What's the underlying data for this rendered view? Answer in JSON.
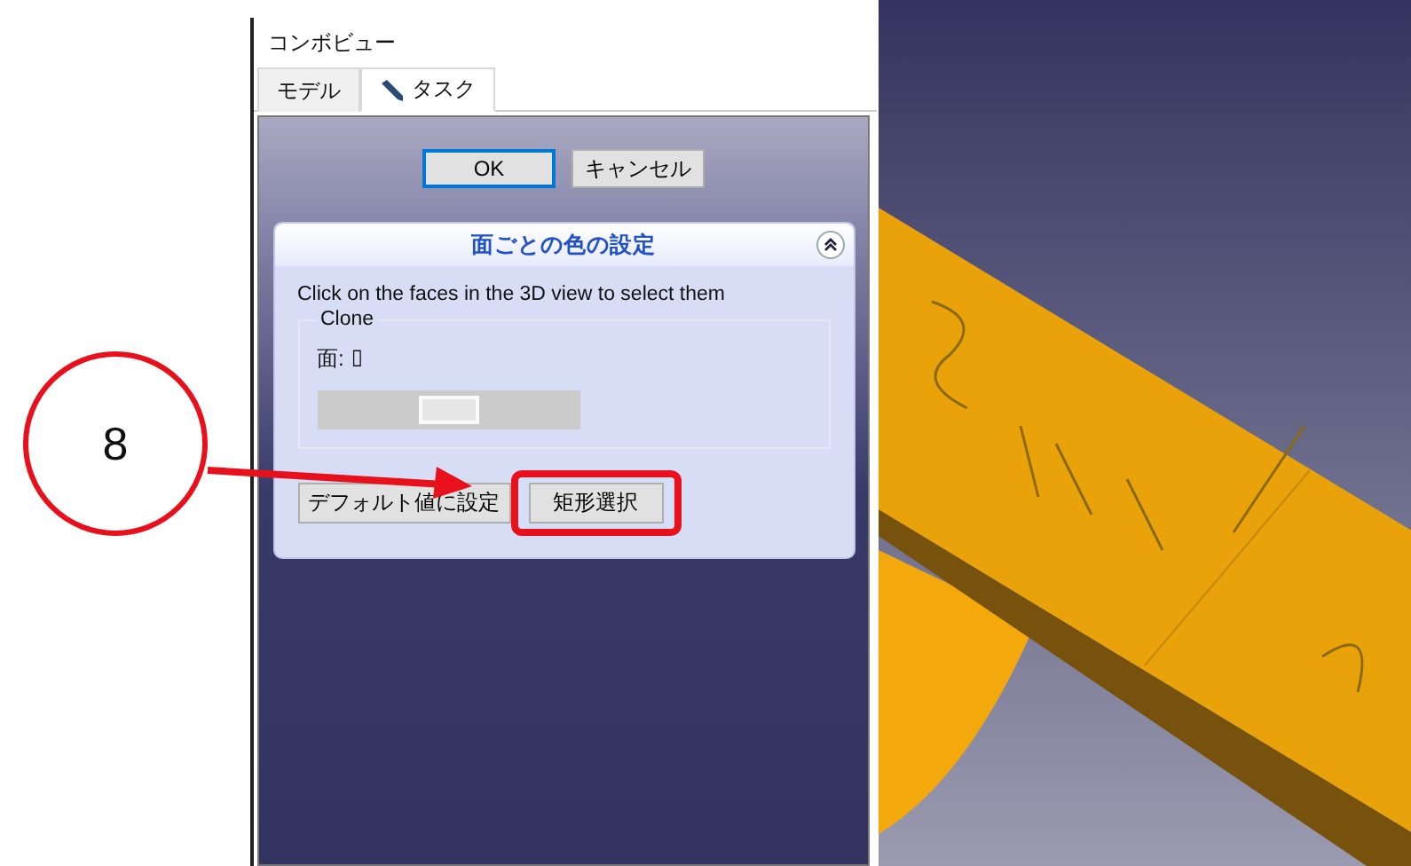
{
  "window": {
    "title": "コンボビュー"
  },
  "tabs": [
    {
      "label": "モデル",
      "selected": false,
      "icon": false
    },
    {
      "label": "タスク",
      "selected": true,
      "icon": true
    }
  ],
  "dialog_buttons": [
    {
      "label": "OK",
      "default": true
    },
    {
      "label": "キャンセル",
      "default": false
    }
  ],
  "task_box": {
    "title": "面ごとの色の設定",
    "expanded": true,
    "instruction": "Click on the faces in the 3D view to select them",
    "group": {
      "title": "Clone",
      "face_label": "面:",
      "face_value": "▯"
    },
    "buttons": [
      {
        "label": "デフォルト値に設定",
        "highlighted": false
      },
      {
        "label": "矩形選択",
        "highlighted": true
      }
    ]
  },
  "callout": {
    "number": "8"
  }
}
